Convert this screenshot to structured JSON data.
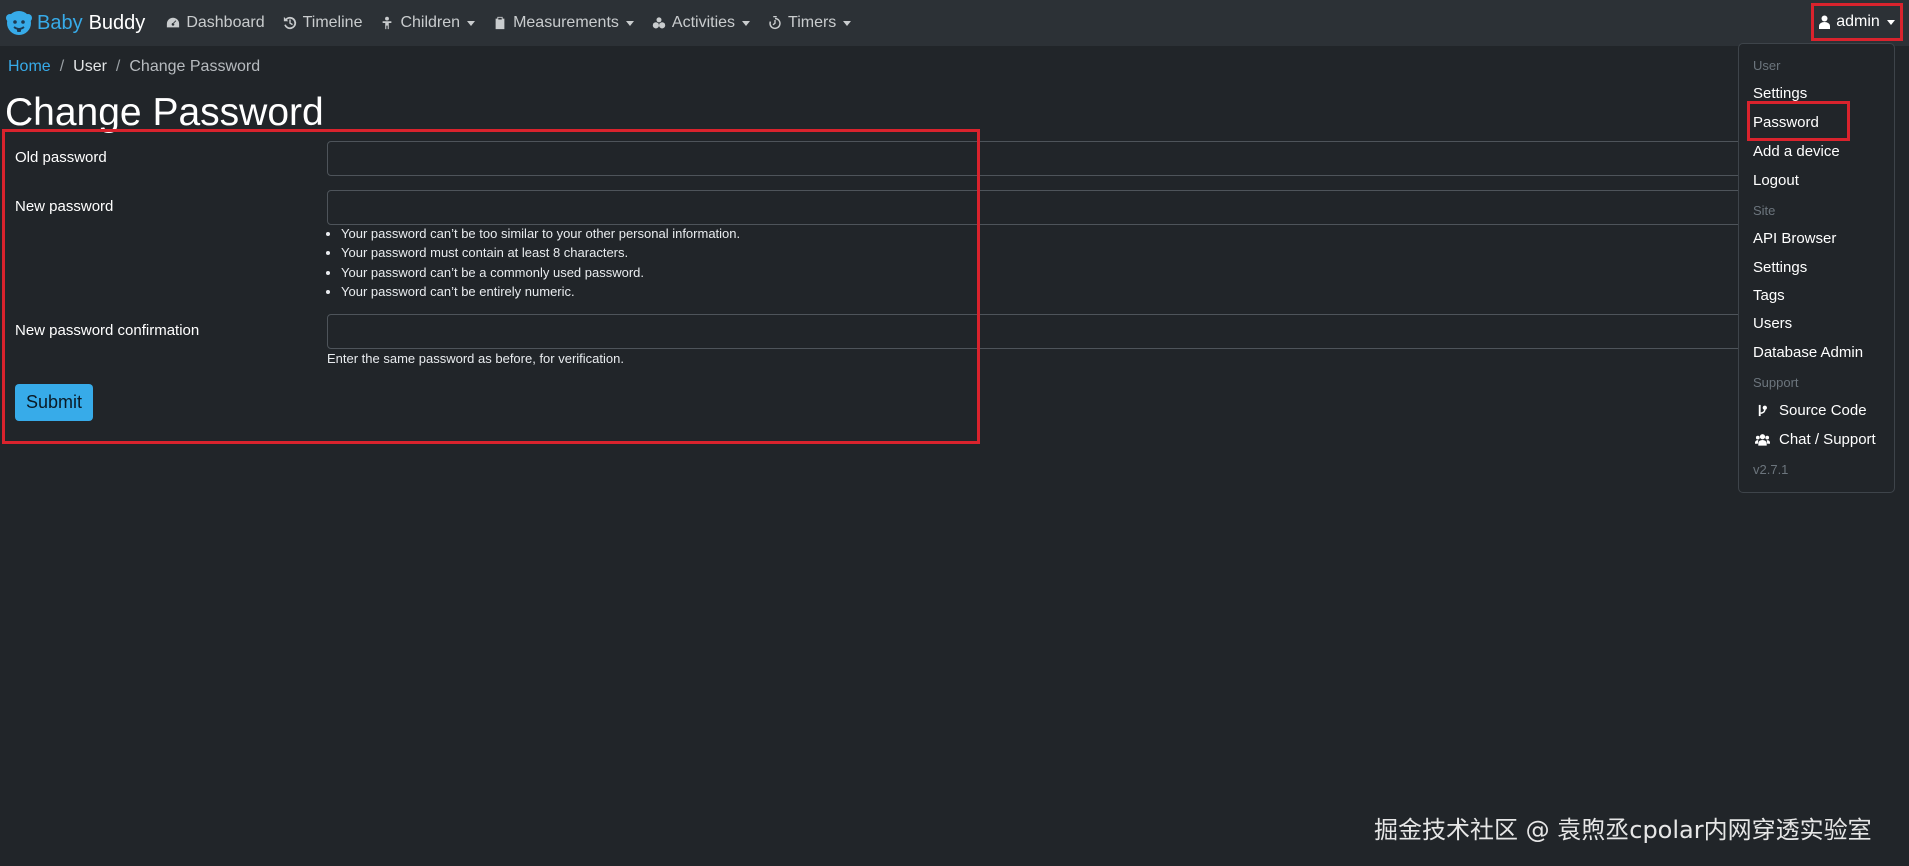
{
  "navbar": {
    "brand_baby": "Baby",
    "brand_buddy": "Buddy",
    "items": [
      {
        "label": "Dashboard",
        "icon": "dashboard-icon",
        "dropdown": false
      },
      {
        "label": "Timeline",
        "icon": "history-icon",
        "dropdown": false
      },
      {
        "label": "Children",
        "icon": "child-icon",
        "dropdown": true
      },
      {
        "label": "Measurements",
        "icon": "clipboard-icon",
        "dropdown": true
      },
      {
        "label": "Activities",
        "icon": "activities-icon",
        "dropdown": true
      },
      {
        "label": "Timers",
        "icon": "timer-icon",
        "dropdown": true
      }
    ],
    "user": "admin"
  },
  "breadcrumb": {
    "home": "Home",
    "user": "User",
    "sep": "/",
    "current": "Change Password"
  },
  "page_title": "Change Password",
  "form": {
    "old_password_label": "Old password",
    "new_password_label": "New password",
    "new_password_help": [
      "Your password can’t be too similar to your other personal information.",
      "Your password must contain at least 8 characters.",
      "Your password can’t be a commonly used password.",
      "Your password can’t be entirely numeric."
    ],
    "confirmation_label": "New password confirmation",
    "confirmation_help": "Enter the same password as before, for verification.",
    "submit_label": "Submit"
  },
  "user_menu": {
    "user_header": "User",
    "settings": "Settings",
    "password": "Password",
    "add_device": "Add a device",
    "logout": "Logout",
    "site_header": "Site",
    "api_browser": "API Browser",
    "site_settings": "Settings",
    "tags": "Tags",
    "users": "Users",
    "database_admin": "Database Admin",
    "support_header": "Support",
    "source_code": "Source Code",
    "chat_support": "Chat / Support",
    "version": "v2.7.1"
  },
  "watermark": "掘金技术社区 @ 袁煦丞cpolar内网穿透实验室",
  "colors": {
    "accent": "#37abe9",
    "highlight": "#d9232d",
    "background": "#212529",
    "navbar": "#2c3136"
  }
}
